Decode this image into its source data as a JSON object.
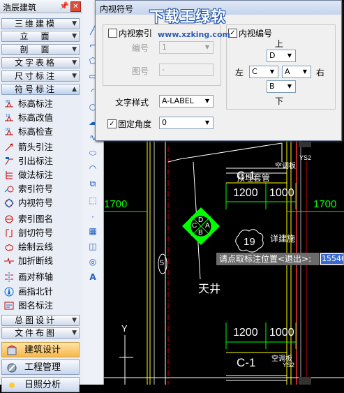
{
  "left_panel": {
    "title": "浩辰建筑",
    "pin_icon": "pin-icon",
    "close_icon": "close-icon",
    "categories": [
      {
        "label": "三维建模"
      },
      {
        "label": "立　面"
      },
      {
        "label": "剖　面"
      },
      {
        "label": "文字表格"
      },
      {
        "label": "尺寸标注"
      },
      {
        "label": "符号标注"
      }
    ],
    "items": [
      {
        "label": "标高标注",
        "icon": "elevation-mark-icon"
      },
      {
        "label": "标高改值",
        "icon": "elevation-edit-icon"
      },
      {
        "label": "标高检查",
        "icon": "elevation-check-icon"
      },
      {
        "label": "箭头引注",
        "icon": "arrow-leader-icon"
      },
      {
        "label": "引出标注",
        "icon": "leader-note-icon"
      },
      {
        "label": "做法标注",
        "icon": "method-note-icon"
      },
      {
        "label": "索引符号",
        "icon": "index-symbol-icon"
      },
      {
        "label": "内视符号",
        "icon": "interior-view-icon"
      },
      {
        "label": "索引图名",
        "icon": "index-title-icon"
      },
      {
        "label": "剖切符号",
        "icon": "section-symbol-icon"
      },
      {
        "label": "绘制云线",
        "icon": "cloud-line-icon"
      },
      {
        "label": "加折断线",
        "icon": "break-line-icon"
      },
      {
        "label": "画对称轴",
        "icon": "symmetry-axis-icon"
      },
      {
        "label": "画指北针",
        "icon": "north-arrow-icon"
      },
      {
        "label": "图名标注",
        "icon": "drawing-title-icon"
      }
    ],
    "bottom_categories": [
      {
        "label": "总图设计"
      },
      {
        "label": "文件布图"
      }
    ],
    "modules": [
      {
        "label": "建筑设计",
        "icon": "building-design-icon"
      },
      {
        "label": "工程管理",
        "icon": "project-manage-icon"
      },
      {
        "label": "日照分析",
        "icon": "sunlight-icon"
      }
    ]
  },
  "dialog": {
    "title": "内视符号",
    "interior_index": {
      "label": "内视索引",
      "checked": false
    },
    "number_label": "编号",
    "number_value": "1",
    "drawing_label": "图号",
    "drawing_value": "-",
    "interior_number": {
      "label": "内视编号",
      "checked": true
    },
    "dir_up": "上",
    "dir_down": "下",
    "dir_left": "左",
    "dir_right": "右",
    "top_value": "D",
    "left_value": "C",
    "center_value": "A",
    "bottom_value": "B",
    "text_style_label": "文字样式",
    "text_style_value": "A-LABEL",
    "fixed_angle": {
      "label": "固定角度",
      "checked": true
    },
    "angle_value": "0"
  },
  "watermark": {
    "title": "下载王绿软",
    "url": "www.xzking.com"
  },
  "drawing": {
    "dim_1700_left": "1700",
    "dim_1700_right": "1700",
    "dim_1200_top": "1200",
    "dim_1000_top": "1000",
    "dim_1200_bottom": "1200",
    "dim_1000_bottom": "1000",
    "c1_top": "C-1",
    "c1_bottom": "C-1",
    "kongtiao_top": "空调板",
    "kongtiao_bottom": "空调板",
    "ys2_top": "YS2",
    "ys2_bottom": "YS2",
    "yumai": "预埋套管",
    "jiangjianzhu": "详建施",
    "bubble_num": "19",
    "tianjing": "天井",
    "axis_y": "Y",
    "symbol_top": "D",
    "symbol_left": "C",
    "symbol_right": "A",
    "symbol_bottom": "B",
    "circle_label": "5"
  },
  "prompt": {
    "text": "请点取标注位置<退出>:",
    "input": "15546"
  }
}
